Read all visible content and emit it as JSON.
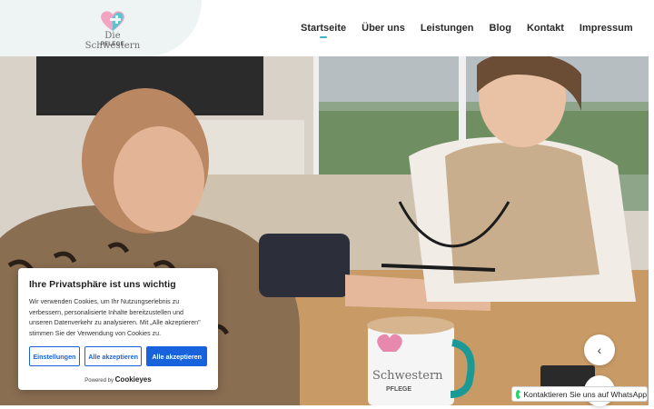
{
  "brand": {
    "name": "Die Schwestern",
    "subtitle": "PFLEGE",
    "heart_colors": [
      "#f2a5c0",
      "#5fc2d0"
    ]
  },
  "nav": {
    "items": [
      {
        "label": "Startseite",
        "active": true
      },
      {
        "label": "Über uns",
        "active": false
      },
      {
        "label": "Leistungen",
        "active": false
      },
      {
        "label": "Blog",
        "active": false
      },
      {
        "label": "Kontakt",
        "active": false
      },
      {
        "label": "Impressum",
        "active": false
      }
    ]
  },
  "hero": {
    "mug_text": "Schwestern",
    "mug_sub": "PFLEGE"
  },
  "cookie": {
    "title": "Ihre Privatsphäre ist uns wichtig",
    "text": "Wir verwenden Cookies, um Ihr Nutzungserlebnis zu verbessern, personalisierte Inhalte bereitzustellen und unseren Datenverkehr zu analysieren. Mit „Alle akzeptieren\" stimmen Sie der Verwendung von Cookies zu.",
    "btn_settings": "Einstellungen",
    "btn_accept_1": "Alle akzeptieren",
    "btn_accept_2": "Alle akzeptieren",
    "powered_by": "Powered by",
    "powered_brand": "Cookieyes"
  },
  "slider": {
    "prev_icon": "chevron-left-icon"
  },
  "whatsapp": {
    "label": "Kontaktieren Sie uns auf WhatsApp",
    "color": "#25d366"
  },
  "colors": {
    "accent": "#3fb2c5",
    "button_blue": "#1863dc"
  }
}
